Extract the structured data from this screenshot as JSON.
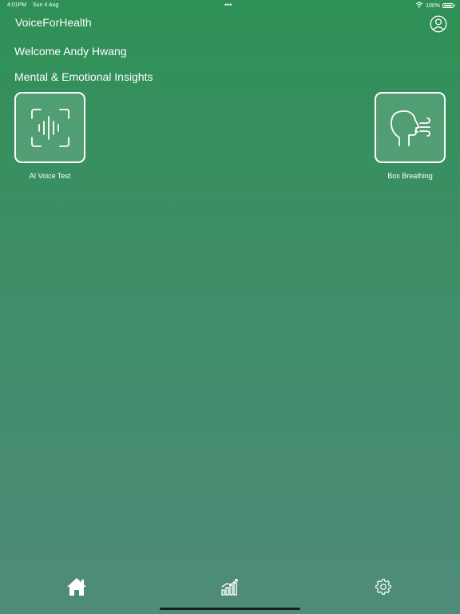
{
  "status_bar": {
    "time": "4:01PM",
    "date": "Sun 4 Aug",
    "dots": "•••",
    "battery": "100%",
    "wifi_icon": "wifi-icon",
    "battery_icon": "battery-icon"
  },
  "header": {
    "app_title": "VoiceForHealth",
    "profile_icon": "user-circle-icon"
  },
  "welcome_text": "Welcome Andy Hwang",
  "section": {
    "title": "Mental & Emotional Insights",
    "tiles": [
      {
        "label": "AI Voice Test",
        "icon": "voice-scan-icon"
      },
      {
        "label": "Box Breathing",
        "icon": "breathing-head-icon"
      }
    ]
  },
  "tab_bar": {
    "items": [
      {
        "name": "home",
        "icon": "home-icon",
        "selected": true
      },
      {
        "name": "stats",
        "icon": "chart-icon",
        "selected": false
      },
      {
        "name": "settings",
        "icon": "gear-icon",
        "selected": false
      }
    ]
  },
  "colors": {
    "gradient_top": "#2e9055",
    "gradient_bottom": "#4f8c7a",
    "foreground": "#ffffff",
    "home_indicator": "#1b1b1b"
  }
}
